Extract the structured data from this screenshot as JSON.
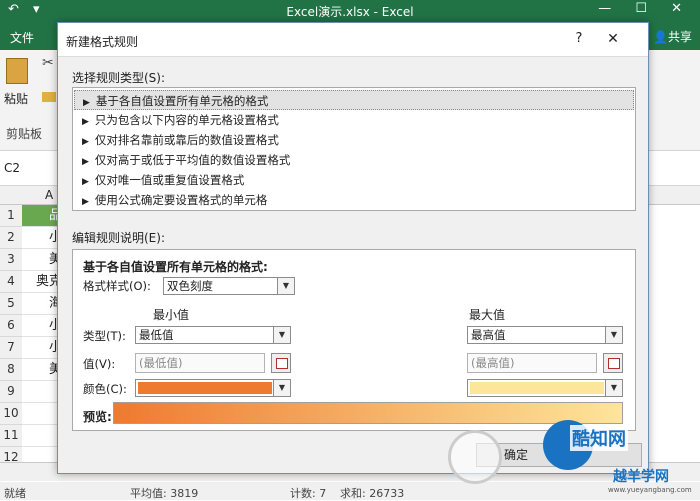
{
  "excel": {
    "window_title": "Excel演示.xlsx - Excel",
    "quick_access": [
      "↶",
      "▾",
      "⋯"
    ],
    "window_controls": "— ☐ ✕",
    "tab_file": "文件",
    "share": "共享",
    "paste": "粘贴",
    "clipboard_group": "剪贴板",
    "name_box": "C2",
    "column_a": "A",
    "rows": [
      {
        "num": "1",
        "value": "品"
      },
      {
        "num": "2",
        "value": "小"
      },
      {
        "num": "3",
        "value": "美"
      },
      {
        "num": "4",
        "value": "奥克"
      },
      {
        "num": "5",
        "value": "海"
      },
      {
        "num": "6",
        "value": "小"
      },
      {
        "num": "7",
        "value": "小"
      },
      {
        "num": "8",
        "value": "美"
      },
      {
        "num": "9",
        "value": ""
      },
      {
        "num": "10",
        "value": ""
      },
      {
        "num": "11",
        "value": ""
      },
      {
        "num": "12",
        "value": ""
      }
    ],
    "status": {
      "ready": "就绪",
      "average": "平均值: 3819",
      "count": "计数: 7",
      "sum": "求和: 26733"
    }
  },
  "dialog": {
    "title": "新建格式规则",
    "help": "?",
    "close": "✕",
    "rule_type_label": "选择规则类型(S):",
    "rule_types": [
      "基于各自值设置所有单元格的格式",
      "只为包含以下内容的单元格设置格式",
      "仅对排名靠前或靠后的数值设置格式",
      "仅对高于或低于平均值的数值设置格式",
      "仅对唯一值或重复值设置格式",
      "使用公式确定要设置格式的单元格"
    ],
    "edit_label": "编辑规则说明(E):",
    "edit": {
      "heading": "基于各自值设置所有单元格的格式:",
      "format_style_label": "格式样式(O):",
      "format_style_value": "双色刻度",
      "min_header": "最小值",
      "max_header": "最大值",
      "type_label": "类型(T):",
      "value_label": "值(V):",
      "color_label": "颜色(C):",
      "min_type": "最低值",
      "max_type": "最高值",
      "min_value_placeholder": "(最低值)",
      "max_value_placeholder": "(最高值)",
      "min_color": "#ee7a30",
      "max_color": "#fde59a",
      "preview_label": "预览:"
    },
    "ok": "确定"
  },
  "watermark": {
    "brand": "酷知网",
    "sub": "越羊学网",
    "url": "www.yueyangbang.com"
  }
}
